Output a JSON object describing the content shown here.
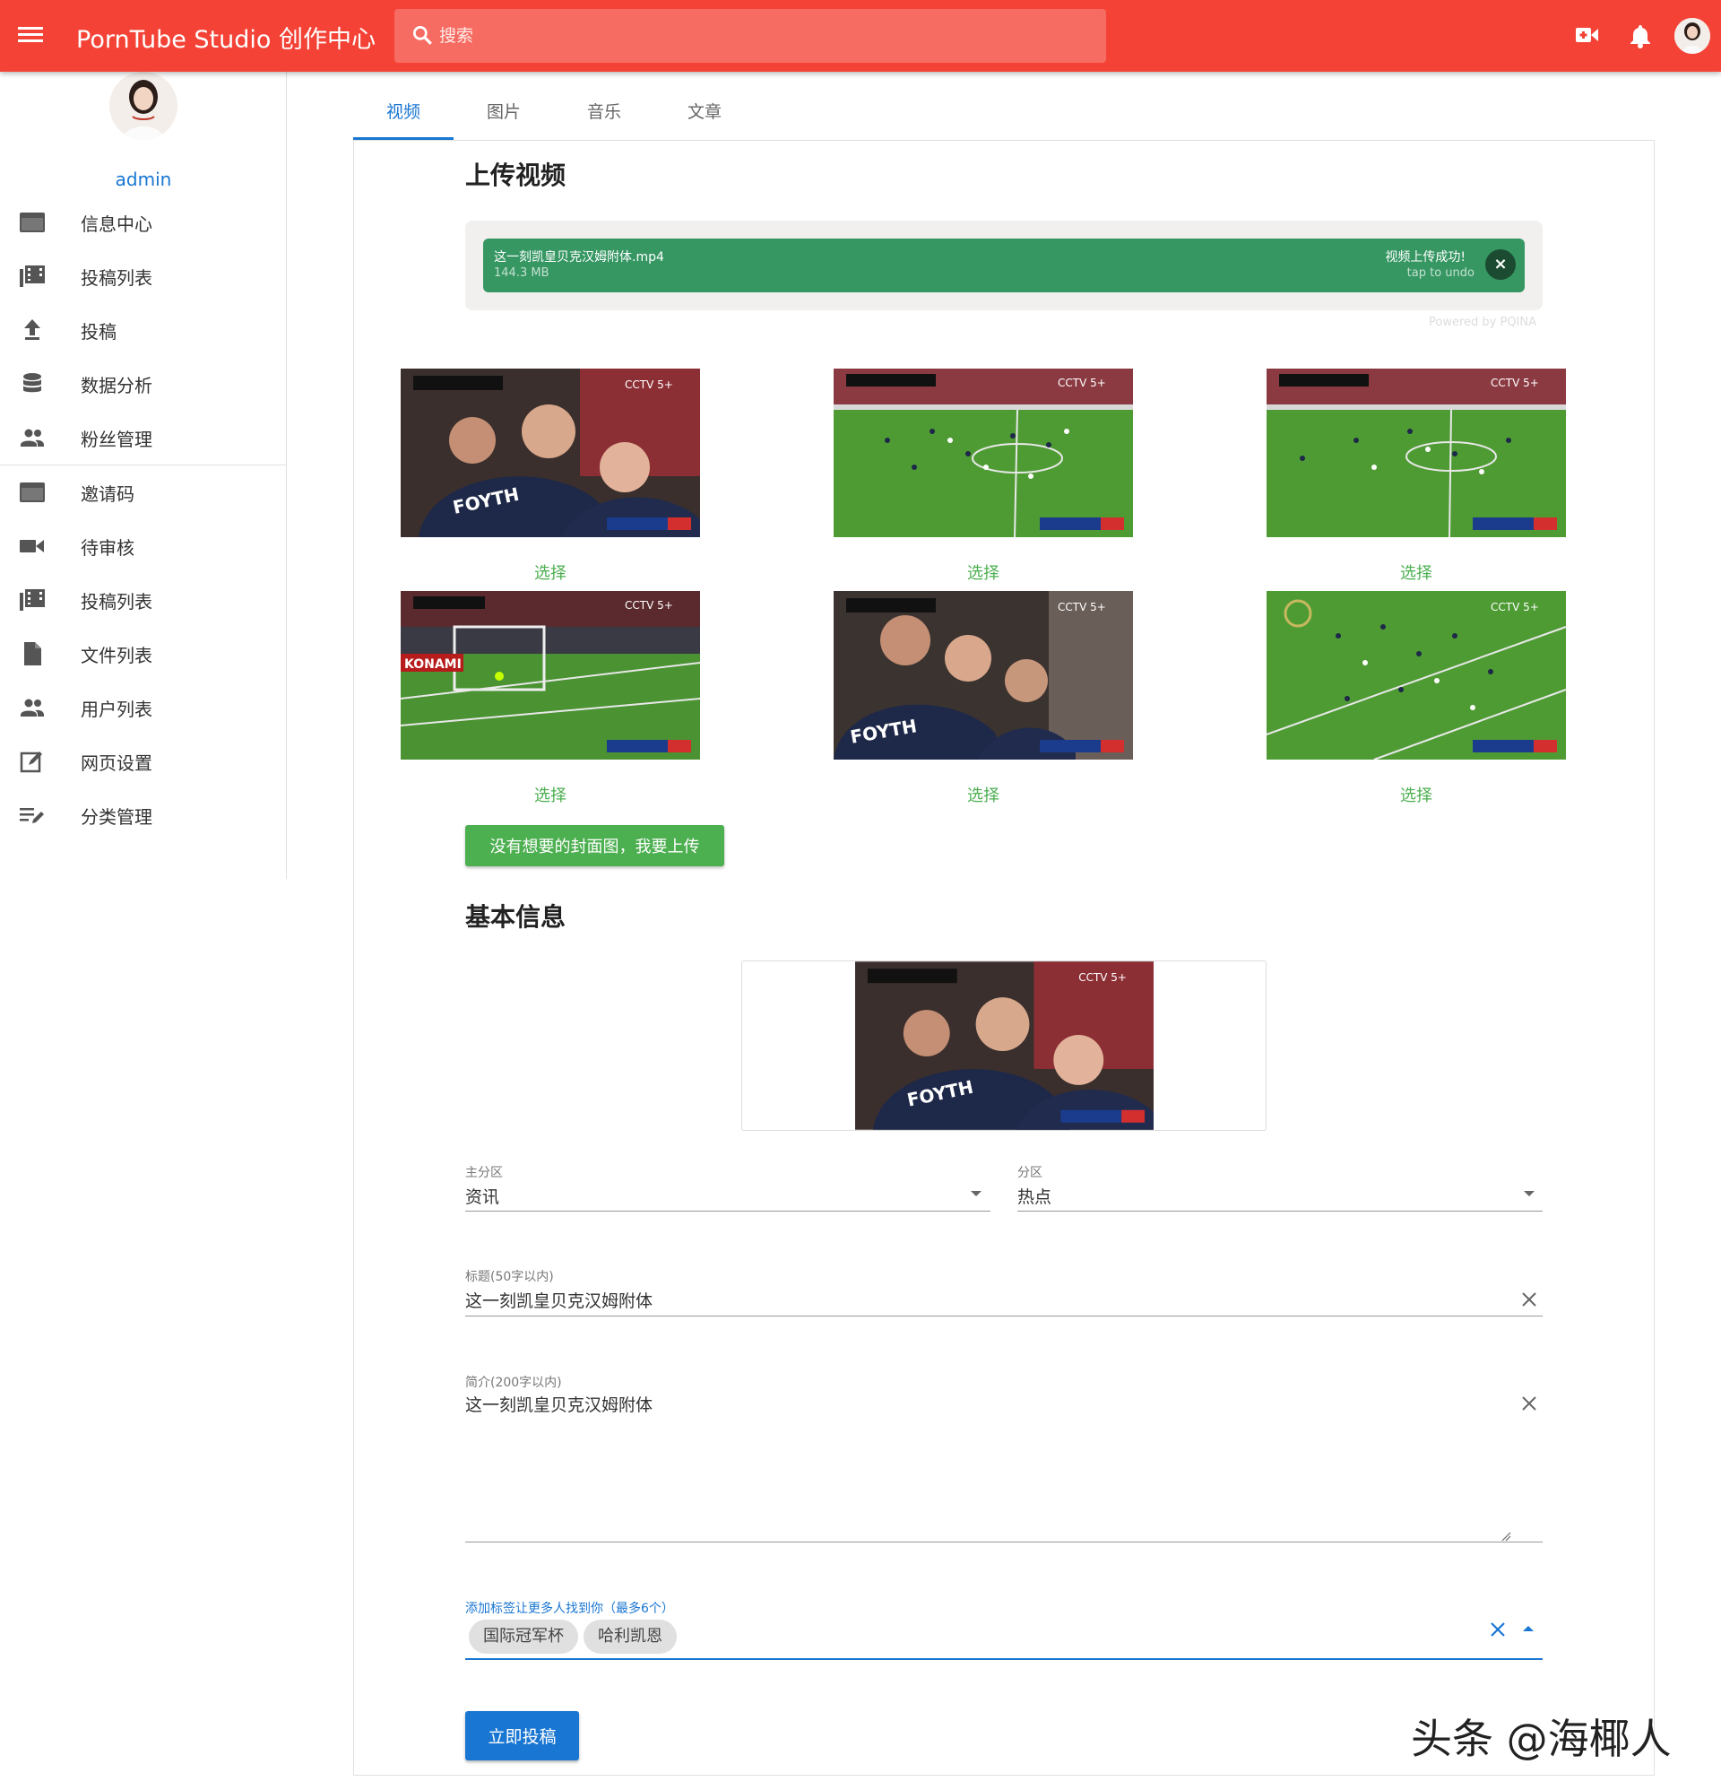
{
  "header": {
    "title": "PornTube Studio 创作中心",
    "search_placeholder": "搜索",
    "icons": [
      "menu-icon",
      "search-icon",
      "video-call-icon",
      "bell-icon",
      "avatar"
    ],
    "accent": "#f44336"
  },
  "sidebar": {
    "username": "admin",
    "items": [
      {
        "label": "信息中心",
        "icon": "dashboard-icon"
      },
      {
        "label": "投稿列表",
        "icon": "library-icon"
      },
      {
        "label": "投稿",
        "icon": "upload-icon"
      },
      {
        "label": "数据分析",
        "icon": "database-icon"
      },
      {
        "label": "粉丝管理",
        "icon": "people-icon"
      },
      {
        "label": "邀请码",
        "icon": "card-icon"
      },
      {
        "label": "待审核",
        "icon": "videocam-icon"
      },
      {
        "label": "投稿列表",
        "icon": "library-icon"
      },
      {
        "label": "文件列表",
        "icon": "file-icon"
      },
      {
        "label": "用户列表",
        "icon": "people-icon"
      },
      {
        "label": "网页设置",
        "icon": "edit-icon"
      },
      {
        "label": "分类管理",
        "icon": "list-edit-icon"
      }
    ]
  },
  "tabs": [
    {
      "label": "视频",
      "active": true
    },
    {
      "label": "图片",
      "active": false
    },
    {
      "label": "音乐",
      "active": false
    },
    {
      "label": "文章",
      "active": false
    }
  ],
  "upload": {
    "heading": "上传视频",
    "file_name": "这一刻凯皇贝克汉姆附体.mp4",
    "file_size": "144.3 MB",
    "status": "视频上传成功!",
    "undo": "tap to undo",
    "powered_by": "Powered by PQINA",
    "success_color": "#369763"
  },
  "covers": {
    "choose_label": "选择",
    "items": [
      {
        "scene": "celebration",
        "jersey": "FOYTH"
      },
      {
        "scene": "pitch-wide"
      },
      {
        "scene": "pitch-wide"
      },
      {
        "scene": "goal",
        "ad": "KONAMI"
      },
      {
        "scene": "celebration",
        "jersey": "FOYTH"
      },
      {
        "scene": "pitch-wide"
      }
    ],
    "upload_button": "没有想要的封面图，我要上传"
  },
  "basic_info": {
    "heading": "基本信息",
    "main_category": {
      "label": "主分区",
      "value": "资讯"
    },
    "sub_category": {
      "label": "分区",
      "value": "热点"
    },
    "title_field": {
      "label": "标题(50字以内)",
      "value": "这一刻凯皇贝克汉姆附体"
    },
    "description_field": {
      "label": "简介(200字以内)",
      "value": "这一刻凯皇贝克汉姆附体"
    },
    "tags_field": {
      "label": "添加标签让更多人找到你（最多6个）",
      "tags": [
        "国际冠军杯",
        "哈利凯恩"
      ]
    },
    "submit_label": "立即投稿"
  },
  "watermark": "头条 @海椰人"
}
